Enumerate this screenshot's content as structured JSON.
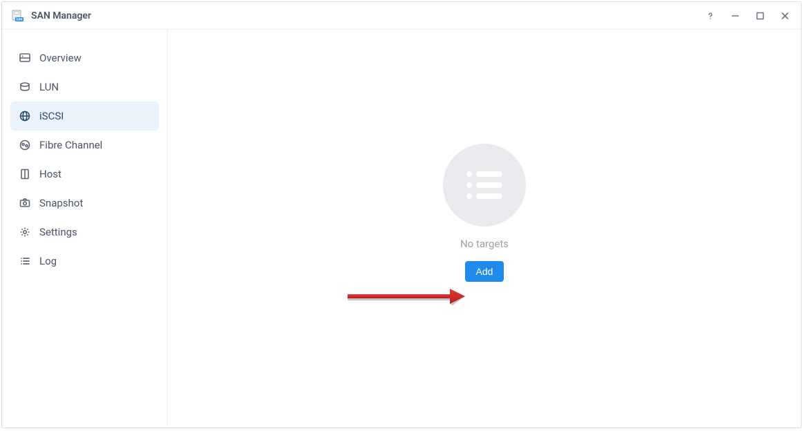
{
  "window": {
    "title": "SAN Manager"
  },
  "sidebar": {
    "items": [
      {
        "id": "overview",
        "label": "Overview",
        "icon": "overview-icon"
      },
      {
        "id": "lun",
        "label": "LUN",
        "icon": "disk-icon"
      },
      {
        "id": "iscsi",
        "label": "iSCSI",
        "icon": "globe-icon",
        "active": true
      },
      {
        "id": "fibre-channel",
        "label": "Fibre Channel",
        "icon": "fc-icon"
      },
      {
        "id": "host",
        "label": "Host",
        "icon": "host-icon"
      },
      {
        "id": "snapshot",
        "label": "Snapshot",
        "icon": "camera-icon"
      },
      {
        "id": "settings",
        "label": "Settings",
        "icon": "gear-icon"
      },
      {
        "id": "log",
        "label": "Log",
        "icon": "list-icon"
      }
    ]
  },
  "main": {
    "empty_text": "No targets",
    "add_label": "Add"
  },
  "annotation": {
    "arrow_color": "#d62a2a"
  }
}
